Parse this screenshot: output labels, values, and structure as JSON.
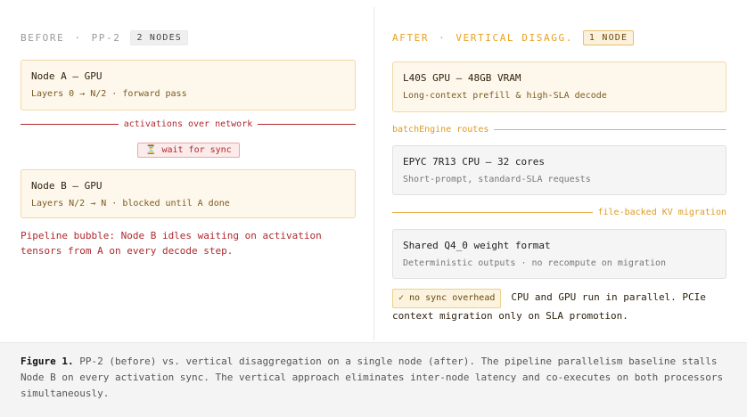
{
  "left": {
    "header": {
      "before": "BEFORE",
      "sep": "·",
      "scheme": "PP-2",
      "badge": "2 NODES"
    },
    "node_a": {
      "title": "Node A — GPU",
      "sub": "Layers 0 → N/2 · forward pass"
    },
    "network_label": "activations over network",
    "wait": {
      "icon": "⏳",
      "label": "wait for sync"
    },
    "node_b": {
      "title": "Node B — GPU",
      "sub": "Layers N/2 → N · blocked until A done"
    },
    "bubble": "Pipeline bubble: Node B idles waiting on activation tensors from A on every decode step."
  },
  "right": {
    "header": {
      "after": "AFTER",
      "sep": "·",
      "scheme": "VERTICAL DISAGG.",
      "badge": "1 NODE"
    },
    "gpu": {
      "title": "L40S GPU — 48GB VRAM",
      "sub": "Long-context prefill & high-SLA decode"
    },
    "routes_label": "batchEngine routes",
    "cpu": {
      "title": "EPYC 7R13 CPU — 32 cores",
      "sub": "Short-prompt, standard-SLA requests"
    },
    "migration_label": "file-backed KV migration",
    "weights": {
      "title": "Shared Q4_0 weight format",
      "sub": "Deterministic outputs · no recompute on migration"
    },
    "sync_badge": "✓ no sync overhead",
    "para": "CPU and GPU run in parallel. PCIe context migration only on SLA promotion."
  },
  "caption": {
    "label": "Figure 1.",
    "text": "PP-2 (before) vs. vertical disaggregation on a single node (after). The pipeline parallelism baseline stalls Node B on every activation sync. The vertical approach eliminates inter-node latency and co-executes on both processors simultaneously."
  }
}
